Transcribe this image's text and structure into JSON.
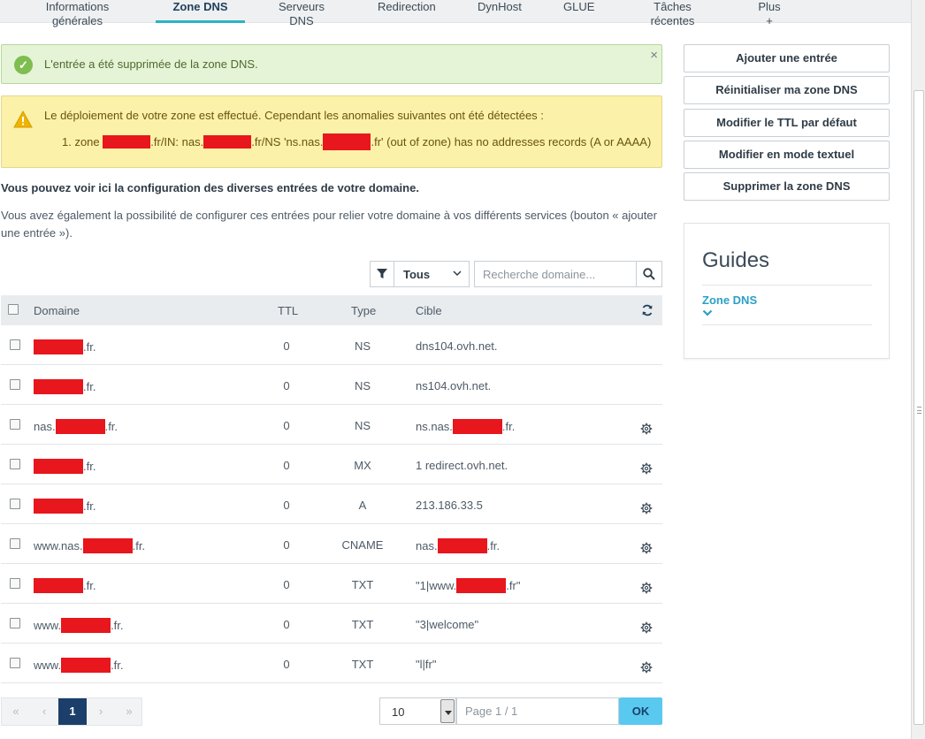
{
  "tabs": [
    {
      "label": "Informations générales",
      "active": false
    },
    {
      "label": "Zone DNS",
      "active": true
    },
    {
      "label": "Serveurs DNS",
      "active": false
    },
    {
      "label": "Redirection",
      "active": false
    },
    {
      "label": "DynHost",
      "active": false
    },
    {
      "label": "GLUE",
      "active": false
    },
    {
      "label": "Tâches récentes",
      "active": false
    },
    {
      "label": "Plus +",
      "active": false
    }
  ],
  "alerts": {
    "success": {
      "text": "L'entrée a été supprimée de la zone DNS.",
      "icon": "check-circle-icon",
      "close": "×"
    },
    "warning": {
      "icon": "warning-triangle-icon",
      "title": "Le déploiement de votre zone est effectué. Cependant les anomalies suivantes ont été détectées :",
      "item_prefix": "1. zone ",
      "item_part2": ".fr/IN: nas.",
      "item_part3": ".fr/NS 'ns.nas.",
      "item_part4": ".fr' (out of zone) has no addresses records (A or AAAA)"
    }
  },
  "intro": {
    "bold": "Vous pouvez voir ici la configuration des diverses entrées de votre domaine.",
    "text": "Vous avez également la possibilité de configurer ces entrées pour relier votre domaine à vos différents services (bouton « ajouter une entrée »)."
  },
  "filter": {
    "type_value": "Tous",
    "search_placeholder": "Recherche domaine..."
  },
  "table": {
    "headers": {
      "domain": "Domaine",
      "ttl": "TTL",
      "type": "Type",
      "target": "Cible"
    },
    "rows": [
      {
        "domain_prefix": "",
        "domain_suffix": ".fr.",
        "ttl": "0",
        "type": "NS",
        "target_prefix": "dns104.ovh.net.",
        "target_suffix": "",
        "target_redacted": false,
        "editable": false
      },
      {
        "domain_prefix": "",
        "domain_suffix": ".fr.",
        "ttl": "0",
        "type": "NS",
        "target_prefix": "ns104.ovh.net.",
        "target_suffix": "",
        "target_redacted": false,
        "editable": false
      },
      {
        "domain_prefix": "nas.",
        "domain_suffix": ".fr.",
        "ttl": "0",
        "type": "NS",
        "target_prefix": "ns.nas.",
        "target_suffix": ".fr.",
        "target_redacted": true,
        "editable": true
      },
      {
        "domain_prefix": "",
        "domain_suffix": ".fr.",
        "ttl": "0",
        "type": "MX",
        "target_prefix": "1 redirect.ovh.net.",
        "target_suffix": "",
        "target_redacted": false,
        "editable": true
      },
      {
        "domain_prefix": "",
        "domain_suffix": ".fr.",
        "ttl": "0",
        "type": "A",
        "target_prefix": "213.186.33.5",
        "target_suffix": "",
        "target_redacted": false,
        "editable": true
      },
      {
        "domain_prefix": "www.nas.",
        "domain_suffix": ".fr.",
        "ttl": "0",
        "type": "CNAME",
        "target_prefix": "nas.",
        "target_suffix": ".fr.",
        "target_redacted": true,
        "editable": true
      },
      {
        "domain_prefix": "",
        "domain_suffix": ".fr.",
        "ttl": "0",
        "type": "TXT",
        "target_prefix": "\"1|www.",
        "target_suffix": ".fr\"",
        "target_redacted": true,
        "editable": true
      },
      {
        "domain_prefix": "www.",
        "domain_suffix": ".fr.",
        "ttl": "0",
        "type": "TXT",
        "target_prefix": "\"3|welcome\"",
        "target_suffix": "",
        "target_redacted": false,
        "editable": true
      },
      {
        "domain_prefix": "www.",
        "domain_suffix": ".fr.",
        "ttl": "0",
        "type": "TXT",
        "target_prefix": "\"l|fr\"",
        "target_suffix": "",
        "target_redacted": false,
        "editable": true
      }
    ]
  },
  "pagination": {
    "first": "«",
    "prev": "‹",
    "current": "1",
    "next": "›",
    "last": "»",
    "page_size": "10",
    "page_placeholder": "Page 1 / 1",
    "ok": "OK"
  },
  "actions": [
    "Ajouter une entrée",
    "Réinitialiser ma zone DNS",
    "Modifier le TTL par défaut",
    "Modifier en mode textuel",
    "Supprimer la zone DNS"
  ],
  "guides": {
    "title": "Guides",
    "link": "Zone DNS"
  },
  "colors": {
    "accent": "#2bb3c5",
    "success_bg": "#e5f3d6",
    "warning_bg": "#fbf1a8",
    "redaction": "#e8161d",
    "primary_dark": "#1b3f6a",
    "ok_button": "#59c9ef"
  }
}
